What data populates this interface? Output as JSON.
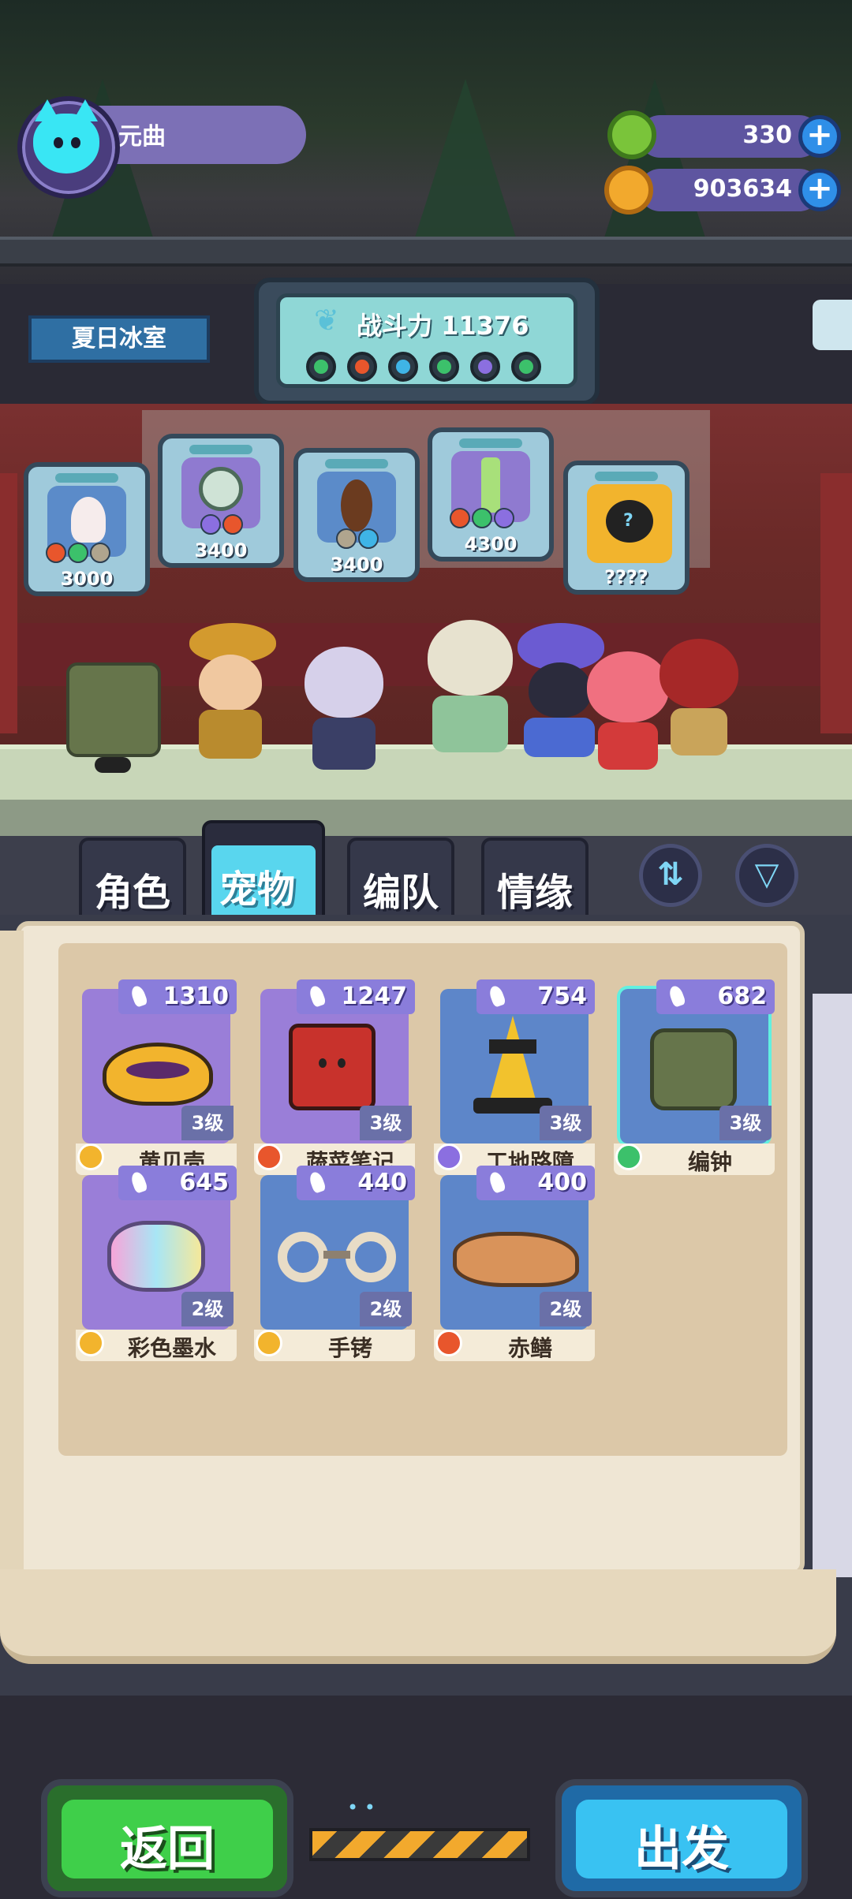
{
  "player": {
    "name": "元曲"
  },
  "currencies": [
    {
      "name": "donut-currency",
      "value": "330",
      "color": "#7ac43a"
    },
    {
      "name": "planet-coin",
      "value": "903634",
      "color": "#f2a92d"
    }
  ],
  "room": {
    "name": "夏日冰室"
  },
  "team": {
    "power_label": "战斗力 11376",
    "elements": [
      "green",
      "fire",
      "water",
      "green",
      "moon",
      "green"
    ]
  },
  "hanging_pets": [
    {
      "power": "3000",
      "elements": [
        "fire",
        "green",
        "gear"
      ]
    },
    {
      "power": "3400",
      "elements": [
        "moon",
        "fire"
      ]
    },
    {
      "power": "3400",
      "elements": [
        "gear",
        "water"
      ]
    },
    {
      "power": "4300",
      "elements": [
        "fire",
        "green",
        "moon"
      ]
    },
    {
      "power": "????",
      "elements": []
    }
  ],
  "tabs": [
    {
      "label": "角色",
      "active": false
    },
    {
      "label": "宠物",
      "active": true
    },
    {
      "label": "编队",
      "active": false
    },
    {
      "label": "情缘",
      "active": false
    }
  ],
  "pets": [
    {
      "name": "黄贝壳",
      "power": "1310",
      "level": "3级",
      "element": "gold",
      "bg": "#9a7ed8"
    },
    {
      "name": "蔬菜笔记",
      "power": "1247",
      "level": "3级",
      "element": "fire",
      "bg": "#9a7ed8"
    },
    {
      "name": "工地路障",
      "power": "754",
      "level": "3级",
      "element": "moon",
      "bg": "#5d86c9"
    },
    {
      "name": "编钟",
      "power": "682",
      "level": "3级",
      "element": "green",
      "bg": "#5d86c9"
    },
    {
      "name": "彩色墨水",
      "power": "645",
      "level": "2级",
      "element": "gold",
      "bg": "#9a7ed8"
    },
    {
      "name": "手铐",
      "power": "440",
      "level": "2级",
      "element": "gold",
      "bg": "#5d86c9"
    },
    {
      "name": "赤鳝",
      "power": "400",
      "level": "2级",
      "element": "fire",
      "bg": "#5d86c9"
    }
  ],
  "buttons": {
    "back": "返回",
    "depart": "出发"
  },
  "element_colors": {
    "fire": "#e8562c",
    "water": "#3fb4e6",
    "green": "#3cc16b",
    "moon": "#8b6fe0",
    "gold": "#f2b42d",
    "gear": "#b0a58e"
  }
}
